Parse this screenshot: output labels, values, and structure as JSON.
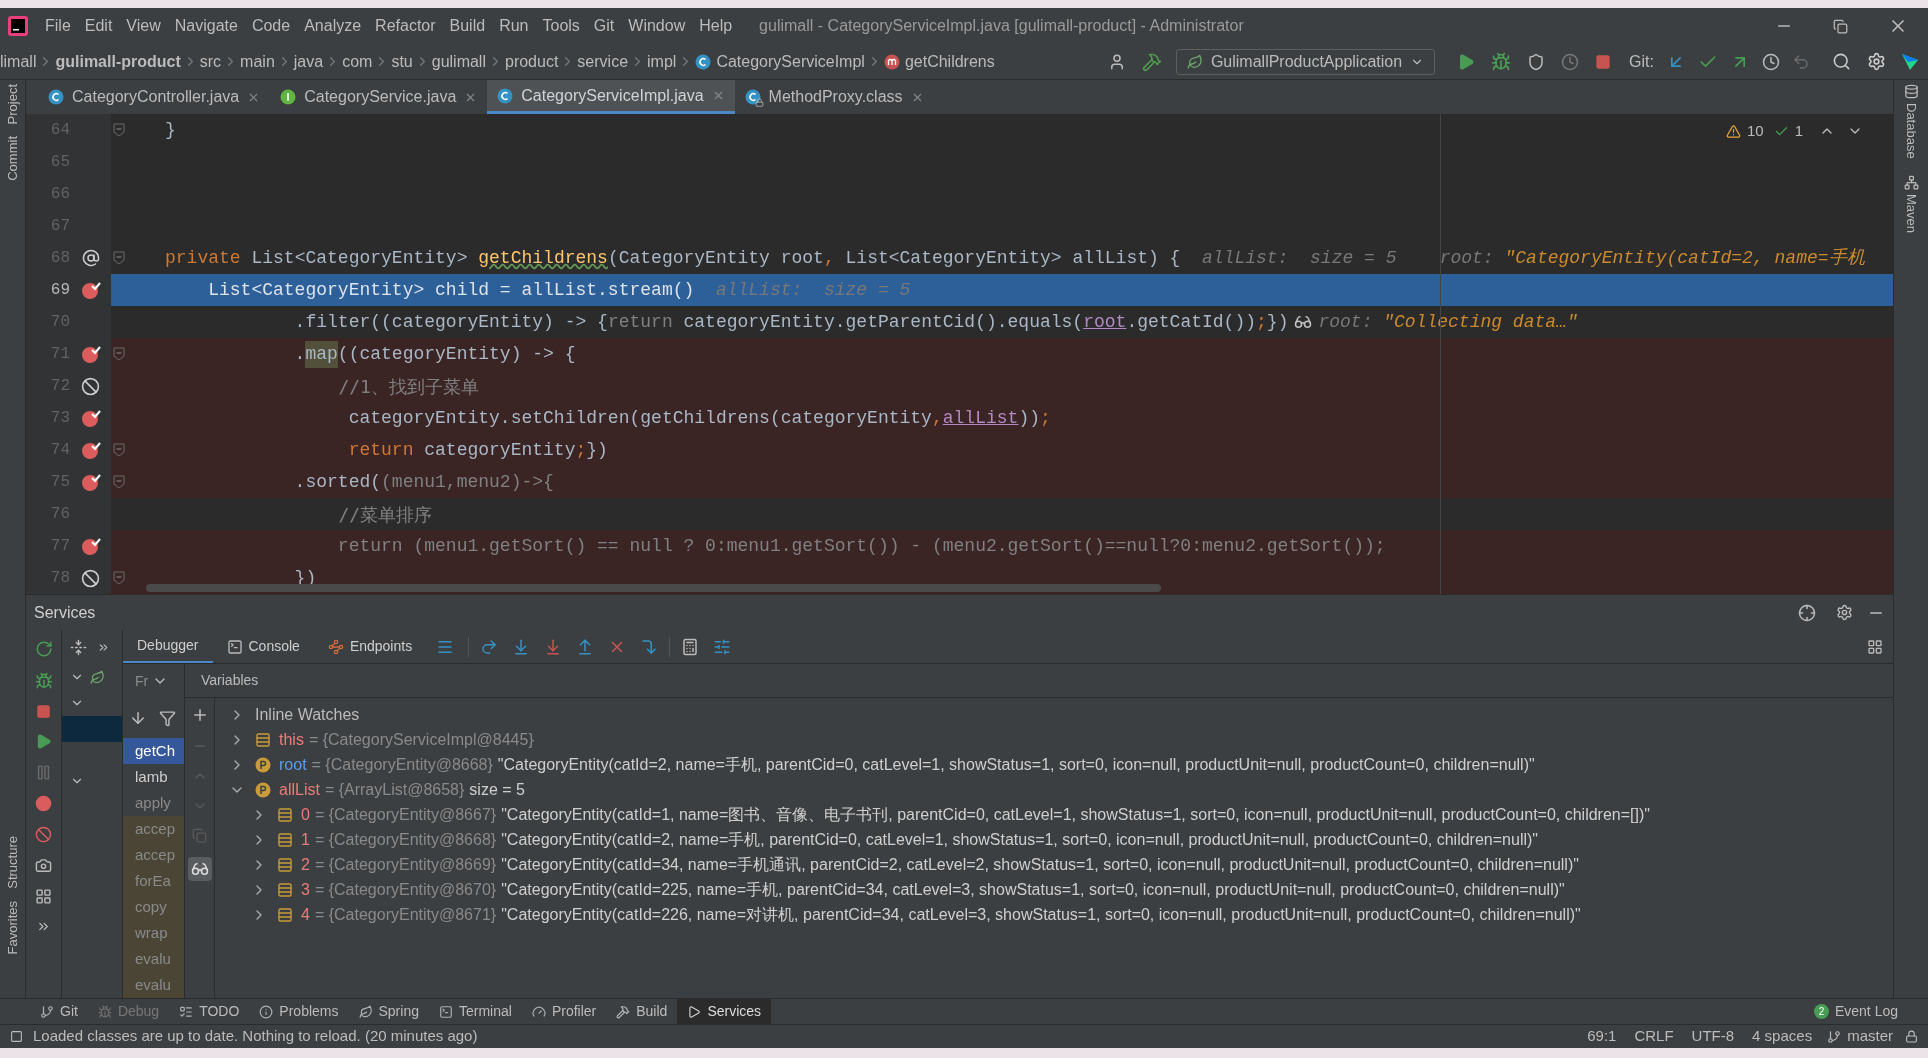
{
  "window": {
    "title": "gulimall - CategoryServiceImpl.java [gulimall-product] - Administrator"
  },
  "menu": [
    "File",
    "Edit",
    "View",
    "Navigate",
    "Code",
    "Analyze",
    "Refactor",
    "Build",
    "Run",
    "Tools",
    "Git",
    "Window",
    "Help"
  ],
  "breadcrumbs": [
    {
      "label": "limall",
      "kind": "folder"
    },
    {
      "label": "gulimall-product",
      "kind": "module"
    },
    {
      "label": "src",
      "kind": "folder"
    },
    {
      "label": "main",
      "kind": "folder"
    },
    {
      "label": "java",
      "kind": "folder"
    },
    {
      "label": "com",
      "kind": "folder"
    },
    {
      "label": "stu",
      "kind": "folder"
    },
    {
      "label": "gulimall",
      "kind": "folder"
    },
    {
      "label": "product",
      "kind": "folder"
    },
    {
      "label": "service",
      "kind": "folder"
    },
    {
      "label": "impl",
      "kind": "folder"
    },
    {
      "label": "CategoryServiceImpl",
      "kind": "class"
    },
    {
      "label": "getChildrens",
      "kind": "method"
    }
  ],
  "toolbar": {
    "run_config": "GulimallProductApplication",
    "git_label": "Git:"
  },
  "tabs": [
    {
      "label": "CategoryController.java",
      "kind": "class",
      "selected": false
    },
    {
      "label": "CategoryService.java",
      "kind": "interface",
      "selected": false
    },
    {
      "label": "CategoryServiceImpl.java",
      "kind": "class",
      "selected": true
    },
    {
      "label": "MethodProxy.class",
      "kind": "locked_class",
      "selected": false
    }
  ],
  "left_strip": {
    "top": [
      "Project",
      "Commit"
    ],
    "bottom": [
      "Structure",
      "Favorites"
    ]
  },
  "right_strip": [
    "Database",
    "Maven"
  ],
  "inspections": {
    "warnings": "10",
    "weak_warnings": "1"
  },
  "editor": {
    "lines": [
      {
        "number": "64",
        "current": false,
        "breakpoint": false,
        "muted": false,
        "override": false,
        "fold": true,
        "tokens": [
          {
            "t": "}",
            "kind": "plain"
          }
        ]
      },
      {
        "number": "65",
        "current": false,
        "breakpoint": false,
        "muted": false,
        "override": false,
        "fold": false
      },
      {
        "number": "66",
        "current": false,
        "breakpoint": false,
        "muted": false,
        "override": false,
        "fold": false
      },
      {
        "number": "67",
        "current": false,
        "breakpoint": false,
        "muted": false,
        "override": false,
        "fold": false
      },
      {
        "number": "68",
        "current": false,
        "breakpoint": false,
        "override": true,
        "fold": true,
        "tokens": [
          {
            "t": "private ",
            "kind": "keyword"
          },
          {
            "t": "List<CategoryEntity> ",
            "kind": "plain"
          },
          {
            "t": "getChildrens",
            "kind": "method"
          },
          {
            "t": "(CategoryEntity root",
            "kind": "plain"
          },
          {
            "t": ", ",
            "kind": "keyword"
          },
          {
            "t": "List<CategoryEntity> allList) {",
            "kind": "plain"
          },
          {
            "t": "  allList:  size = 5",
            "kind": "hint"
          },
          {
            "t": "    root: ",
            "kind": "hint"
          },
          {
            "t": "\"CategoryEntity(catId=2, name=手机",
            "kind": "hintstr"
          }
        ]
      },
      {
        "number": "69",
        "current": true,
        "breakpoint": true,
        "muted": false,
        "override": false,
        "fold": false,
        "tokens": [
          {
            "t": "    List<CategoryEntity> child = allList.stream()",
            "kind": "plain"
          },
          {
            "t": "  allList:  size = 5",
            "kind": "hint"
          }
        ]
      },
      {
        "number": "70",
        "current": false,
        "breakpoint": false,
        "muted": false,
        "override": false,
        "fold": false,
        "tokens": [
          {
            "t": "            .filter((categoryEntity) -> {",
            "kind": "plain"
          },
          {
            "t": "return ",
            "kind": "faded"
          },
          {
            "t": "categoryEntity.getParentCid().equals(",
            "kind": "plain"
          },
          {
            "t": "root",
            "kind": "link"
          },
          {
            "t": ".getCatId())",
            "kind": "plain"
          },
          {
            "t": ";",
            "kind": "keyword"
          },
          {
            "t": "})",
            "kind": "plain"
          },
          {
            "kind": "watch"
          },
          {
            "t": "root: ",
            "kind": "hint"
          },
          {
            "t": "\"Collecting data…\"",
            "kind": "hintstr"
          }
        ]
      },
      {
        "number": "71",
        "current": false,
        "breakpoint": true,
        "muted": false,
        "override": false,
        "fold": true,
        "tokens": [
          {
            "t": "            .",
            "kind": "plain"
          },
          {
            "t": "map",
            "kind": "usage"
          },
          {
            "t": "((categoryEntity) -> {",
            "kind": "plain"
          }
        ]
      },
      {
        "number": "72",
        "current": false,
        "breakpoint": true,
        "muted": true,
        "override": false,
        "fold": false,
        "tokens": [
          {
            "t": "                //1、找到子菜单",
            "kind": "comment"
          }
        ]
      },
      {
        "number": "73",
        "current": false,
        "breakpoint": true,
        "muted": false,
        "override": false,
        "fold": false,
        "tokens": [
          {
            "t": "                 categoryEntity.setChildren(getChildrens(categoryEntity",
            "kind": "plain"
          },
          {
            "t": ",",
            "kind": "keyword"
          },
          {
            "t": "allList",
            "kind": "link"
          },
          {
            "t": "))",
            "kind": "plain"
          },
          {
            "t": ";",
            "kind": "keyword"
          }
        ]
      },
      {
        "number": "74",
        "current": false,
        "breakpoint": true,
        "muted": false,
        "override": false,
        "fold": true,
        "tokens": [
          {
            "t": "                 return ",
            "kind": "keyword"
          },
          {
            "t": "categoryEntity",
            "kind": "plain"
          },
          {
            "t": ";",
            "kind": "keyword"
          },
          {
            "t": "})",
            "kind": "plain"
          }
        ]
      },
      {
        "number": "75",
        "current": false,
        "breakpoint": true,
        "muted": false,
        "override": false,
        "fold": true,
        "tokens": [
          {
            "t": "            .sorted(",
            "kind": "plain"
          },
          {
            "t": "(menu1,menu2)->{",
            "kind": "faded"
          }
        ]
      },
      {
        "number": "76",
        "current": false,
        "breakpoint": false,
        "muted": false,
        "override": false,
        "fold": false,
        "tokens": [
          {
            "t": "                //菜单排序",
            "kind": "comment"
          }
        ]
      },
      {
        "number": "77",
        "current": false,
        "breakpoint": true,
        "muted": false,
        "override": false,
        "fold": false,
        "tokens": [
          {
            "t": "                return (menu1.getSort() == null ? 0:menu1.getSort()) - (menu2.getSort()==null?0:menu2.getSort());",
            "kind": "faded"
          }
        ]
      },
      {
        "number": "78",
        "current": false,
        "breakpoint": true,
        "muted": true,
        "override": false,
        "fold": true,
        "tokens": [
          {
            "t": "            })",
            "kind": "plain"
          }
        ]
      }
    ]
  },
  "services": {
    "title": "Services",
    "tree": [
      {
        "kind": "folder",
        "selected": false
      },
      {
        "kind": "folder",
        "selected": false
      },
      {
        "kind": "leaf",
        "selected": true
      },
      {
        "kind": "folder",
        "selected": false
      }
    ],
    "debugger_tabs": [
      {
        "label": "Debugger",
        "kind": "debugger",
        "selected": true
      },
      {
        "label": "Console",
        "kind": "console",
        "selected": false
      },
      {
        "label": "Endpoints",
        "kind": "endpoints",
        "selected": false
      }
    ],
    "frames_dropdown": "Fr",
    "frames": [
      {
        "label": "getCh",
        "kind": "user",
        "selected": true
      },
      {
        "label": "lamb",
        "kind": "user",
        "selected": false
      },
      {
        "label": "apply",
        "kind": "library",
        "selected": false
      },
      {
        "label": "accep",
        "kind": "async",
        "selected": false
      },
      {
        "label": "accep",
        "kind": "async",
        "selected": false
      },
      {
        "label": "forEa",
        "kind": "async",
        "selected": false
      },
      {
        "label": "copy",
        "kind": "async",
        "selected": false
      },
      {
        "label": "wrap",
        "kind": "async",
        "selected": false
      },
      {
        "label": "evalu",
        "kind": "async",
        "selected": false
      },
      {
        "label": "evalu",
        "kind": "async",
        "selected": false
      }
    ],
    "variables_title": "Variables",
    "variables": [
      {
        "kind": "group",
        "name": "Inline Watches",
        "expanded": false
      },
      {
        "kind": "field",
        "name": "this",
        "color": "#ee7b7b",
        "ref": "= {CategoryServiceImpl@8445}",
        "expanded": false
      },
      {
        "kind": "param",
        "name": "root",
        "color": "#5c9ef0",
        "ref": "= {CategoryEntity@8668}",
        "value": "\"CategoryEntity(catId=2, name=手机, parentCid=0, catLevel=1, showStatus=1, sort=0, icon=null, productUnit=null, productCount=0, children=null)\"",
        "expanded": false
      },
      {
        "kind": "param",
        "name": "allList",
        "color": "#ee7b7b",
        "ref": "= {ArrayList@8658}",
        "value": "size = 5",
        "expanded": true,
        "children": [
          {
            "kind": "field",
            "name": "0",
            "color": "#ee7b7b",
            "ref": "= {CategoryEntity@8667}",
            "value": "\"CategoryEntity(catId=1, name=图书、音像、电子书刊, parentCid=0, catLevel=1, showStatus=1, sort=0, icon=null, productUnit=null, productCount=0, children=[])\"",
            "expanded": false
          },
          {
            "kind": "field",
            "name": "1",
            "color": "#ee7b7b",
            "ref": "= {CategoryEntity@8668}",
            "value": "\"CategoryEntity(catId=2, name=手机, parentCid=0, catLevel=1, showStatus=1, sort=0, icon=null, productUnit=null, productCount=0, children=null)\"",
            "expanded": false
          },
          {
            "kind": "field",
            "name": "2",
            "color": "#ee7b7b",
            "ref": "= {CategoryEntity@8669}",
            "value": "\"CategoryEntity(catId=34, name=手机通讯, parentCid=2, catLevel=2, showStatus=1, sort=0, icon=null, productUnit=null, productCount=0, children=null)\"",
            "expanded": false
          },
          {
            "kind": "field",
            "name": "3",
            "color": "#ee7b7b",
            "ref": "= {CategoryEntity@8670}",
            "value": "\"CategoryEntity(catId=225, name=手机, parentCid=34, catLevel=3, showStatus=1, sort=0, icon=null, productUnit=null, productCount=0, children=null)\"",
            "expanded": false
          },
          {
            "kind": "field",
            "name": "4",
            "color": "#ee7b7b",
            "ref": "= {CategoryEntity@8671}",
            "value": "\"CategoryEntity(catId=226, name=对讲机, parentCid=34, catLevel=3, showStatus=1, sort=0, icon=null, productUnit=null, productCount=0, children=null)\"",
            "expanded": false
          }
        ]
      }
    ]
  },
  "tool_windows": [
    {
      "label": "Git",
      "kind": "git",
      "selected": false,
      "disabled": false
    },
    {
      "label": "Debug",
      "kind": "debug",
      "selected": false,
      "disabled": true
    },
    {
      "label": "TODO",
      "kind": "todo",
      "selected": false,
      "disabled": false
    },
    {
      "label": "Problems",
      "kind": "problems",
      "selected": false,
      "disabled": false
    },
    {
      "label": "Spring",
      "kind": "spring",
      "selected": false,
      "disabled": false
    },
    {
      "label": "Terminal",
      "kind": "terminal",
      "selected": false,
      "disabled": false
    },
    {
      "label": "Profiler",
      "kind": "profiler",
      "selected": false,
      "disabled": false
    },
    {
      "label": "Build",
      "kind": "build",
      "selected": false,
      "disabled": false
    },
    {
      "label": "Services",
      "kind": "services",
      "selected": true,
      "disabled": false
    }
  ],
  "event_log": {
    "label": "Event Log",
    "count": "2"
  },
  "status_bar": {
    "message": "Loaded classes are up to date. Nothing to reload. (20 minutes ago)",
    "position": "69:1",
    "line_separator": "CRLF",
    "encoding": "UTF-8",
    "indent": "4 spaces",
    "branch": "master"
  }
}
